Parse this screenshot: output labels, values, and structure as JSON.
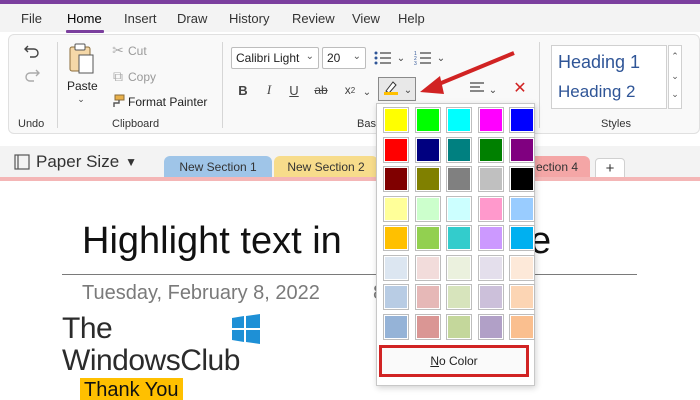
{
  "menu": {
    "items": [
      "File",
      "Home",
      "Insert",
      "Draw",
      "History",
      "Review",
      "View",
      "Help"
    ],
    "active": "Home"
  },
  "ribbon": {
    "undo": {
      "label": "Undo"
    },
    "clipboard": {
      "paste": "Paste",
      "cut": "Cut",
      "copy": "Copy",
      "format_painter": "Format Painter",
      "label": "Clipboard"
    },
    "basic_text": {
      "font": "Calibri Light",
      "size": "20",
      "label_partial": "Basi"
    },
    "styles": {
      "heading1": "Heading 1",
      "heading2": "Heading 2",
      "label": "Styles"
    }
  },
  "notebook": {
    "name": "Paper Size"
  },
  "sections": [
    {
      "label": "New Section 1",
      "color": "#9fc5e8"
    },
    {
      "label": "New Section 2",
      "color": "#f7dc8b"
    },
    {
      "label": "ection 4",
      "color": "#f4a6a6"
    }
  ],
  "page": {
    "title_visible": "Highlight text in",
    "title_tail": "e",
    "date": "Tuesday, February 8, 2022",
    "time_partial": "8",
    "logo_line1": "The",
    "logo_line2": "WindowsClub",
    "highlighted_text": "Thank You"
  },
  "highlight_palette": {
    "rows": [
      [
        "#ffff00",
        "#00ff00",
        "#00ffff",
        "#ff00ff",
        "#0000ff"
      ],
      [
        "#ff0000",
        "#000080",
        "#008080",
        "#008000",
        "#800080"
      ],
      [
        "#800000",
        "#808000",
        "#808080",
        "#c0c0c0",
        "#000000"
      ],
      [
        "#ffff99",
        "#ccffcc",
        "#ccffff",
        "#ff99cc",
        "#99ccff"
      ],
      [
        "#ffc000",
        "#92d050",
        "#33cccc",
        "#cc99ff",
        "#00b0f0"
      ],
      [
        "#dce6f1",
        "#f2dcdb",
        "#ebf1de",
        "#e4dfec",
        "#fde9d9"
      ],
      [
        "#b8cce4",
        "#e6b8b7",
        "#d7e4bc",
        "#ccc0da",
        "#fcd5b4"
      ],
      [
        "#95b3d7",
        "#da9694",
        "#c4d79b",
        "#b1a0c7",
        "#fabf8f"
      ]
    ],
    "no_color_label_first": "N",
    "no_color_label_rest": "o Color"
  },
  "colors": {
    "accent": "#7b3f9e",
    "annotation_red": "#d12323",
    "heading_blue": "#2f5597"
  }
}
